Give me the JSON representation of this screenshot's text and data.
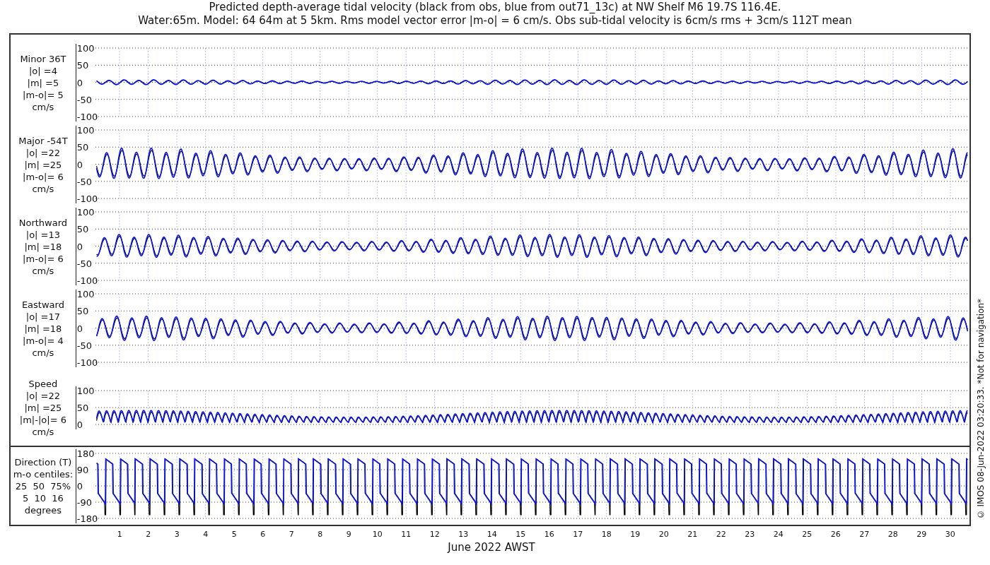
{
  "title_lines": [
    "Predicted depth-average tidal velocity (black from obs, blue from out71_13c) at NW Shelf M6 19.7S 116.4E.",
    "Water:65m. Model: 64 64m at 5 5km. Rms model vector error |m-o| = 6 cm/s. Obs sub-tidal velocity is 6cm/s rms + 3cm/s 112T mean"
  ],
  "panels": [
    {
      "kind": "signed",
      "label_lines": [
        "Minor 36T",
        "|o| =4",
        "|m| =5",
        "|m-o|= 5",
        "cm/s"
      ],
      "yticks": [
        "100",
        "50",
        "0",
        "-50",
        "-100"
      ]
    },
    {
      "kind": "signed",
      "label_lines": [
        "Major -54T",
        "|o| =22",
        "|m| =25",
        "|m-o|= 6",
        "cm/s"
      ],
      "yticks": [
        "100",
        "50",
        "0",
        "-50",
        "-100"
      ]
    },
    {
      "kind": "signed",
      "label_lines": [
        "Northward",
        "|o| =13",
        "|m| =18",
        "|m-o|= 6",
        "cm/s"
      ],
      "yticks": [
        "100",
        "50",
        "0",
        "-50",
        "-100"
      ]
    },
    {
      "kind": "signed",
      "label_lines": [
        "Eastward",
        "|o| =17",
        "|m| =18",
        "|m-o|= 4",
        "cm/s"
      ],
      "yticks": [
        "100",
        "50",
        "0",
        "-50",
        "-100"
      ]
    },
    {
      "kind": "speed",
      "label_lines": [
        "Speed",
        "|o| =22",
        "|m| =25",
        "|m|-|o|= 6",
        "cm/s"
      ],
      "yticks": [
        "100",
        "50",
        "0"
      ]
    },
    {
      "kind": "direction",
      "label_lines": [
        "Direction (T)",
        "m-o centiles:",
        "25  50  75%",
        "5  10  16",
        "degrees"
      ],
      "yticks": [
        "180",
        "90",
        "0",
        "-90",
        "-180"
      ]
    }
  ],
  "x_ticks": [
    "1",
    "2",
    "3",
    "4",
    "5",
    "6",
    "7",
    "8",
    "9",
    "10",
    "11",
    "12",
    "13",
    "14",
    "15",
    "16",
    "17",
    "18",
    "19",
    "20",
    "21",
    "22",
    "23",
    "24",
    "25",
    "26",
    "27",
    "28",
    "29",
    "30"
  ],
  "xlabel": "June 2022 AWST",
  "credit": "© IMOS 08-Jun-2022 03:20:33. *Not for navigation*"
}
